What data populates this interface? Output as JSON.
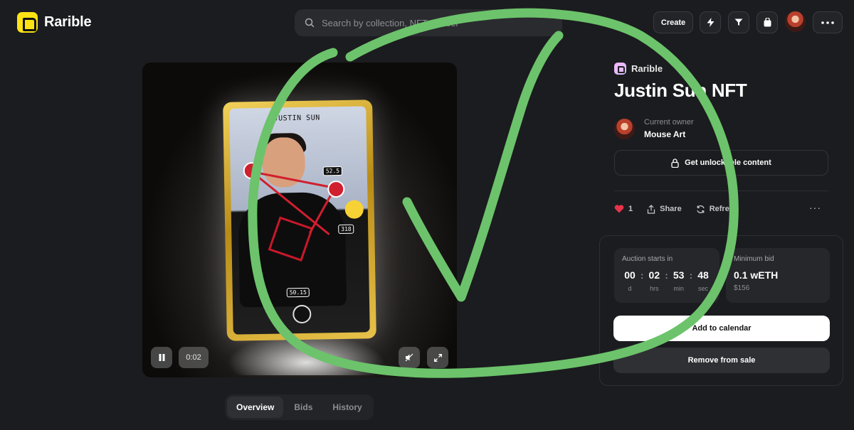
{
  "app": {
    "brand": "Rarible"
  },
  "search": {
    "placeholder": "Search by collection, NFT or user"
  },
  "header": {
    "create_label": "Create",
    "icons": [
      "bolt-icon",
      "filter-icon",
      "bag-icon",
      "more-icon"
    ]
  },
  "nft": {
    "collection": "Rarible",
    "title": "Justin Sun NFT",
    "owner_label": "Current owner",
    "owner_name": "Mouse Art",
    "unlock_label": "Get unlockable content",
    "card_text": "JUSTIN SUN",
    "tags": {
      "a": "52.5",
      "b": "318",
      "c": "50.15"
    }
  },
  "media": {
    "time": "0:02"
  },
  "actions": {
    "likes": "1",
    "share": "Share",
    "refresh": "Refresh"
  },
  "auction": {
    "starts_label": "Auction starts in",
    "days": "00",
    "hours": "02",
    "minutes": "53",
    "seconds": "48",
    "unit_d": "d",
    "unit_hrs": "hrs",
    "unit_min": "min",
    "unit_sec": "sec",
    "min_bid_label": "Minimum bid",
    "min_bid": "0.1 wETH",
    "min_bid_usd": "$156",
    "calendar_label": "Add to calendar",
    "remove_label": "Remove from sale"
  },
  "tabs": [
    "Overview",
    "Bids",
    "History"
  ],
  "colors": {
    "accent": "#fee314",
    "background": "#1b1c1f",
    "annotation": "#6cc36b",
    "like": "#e8344a"
  }
}
